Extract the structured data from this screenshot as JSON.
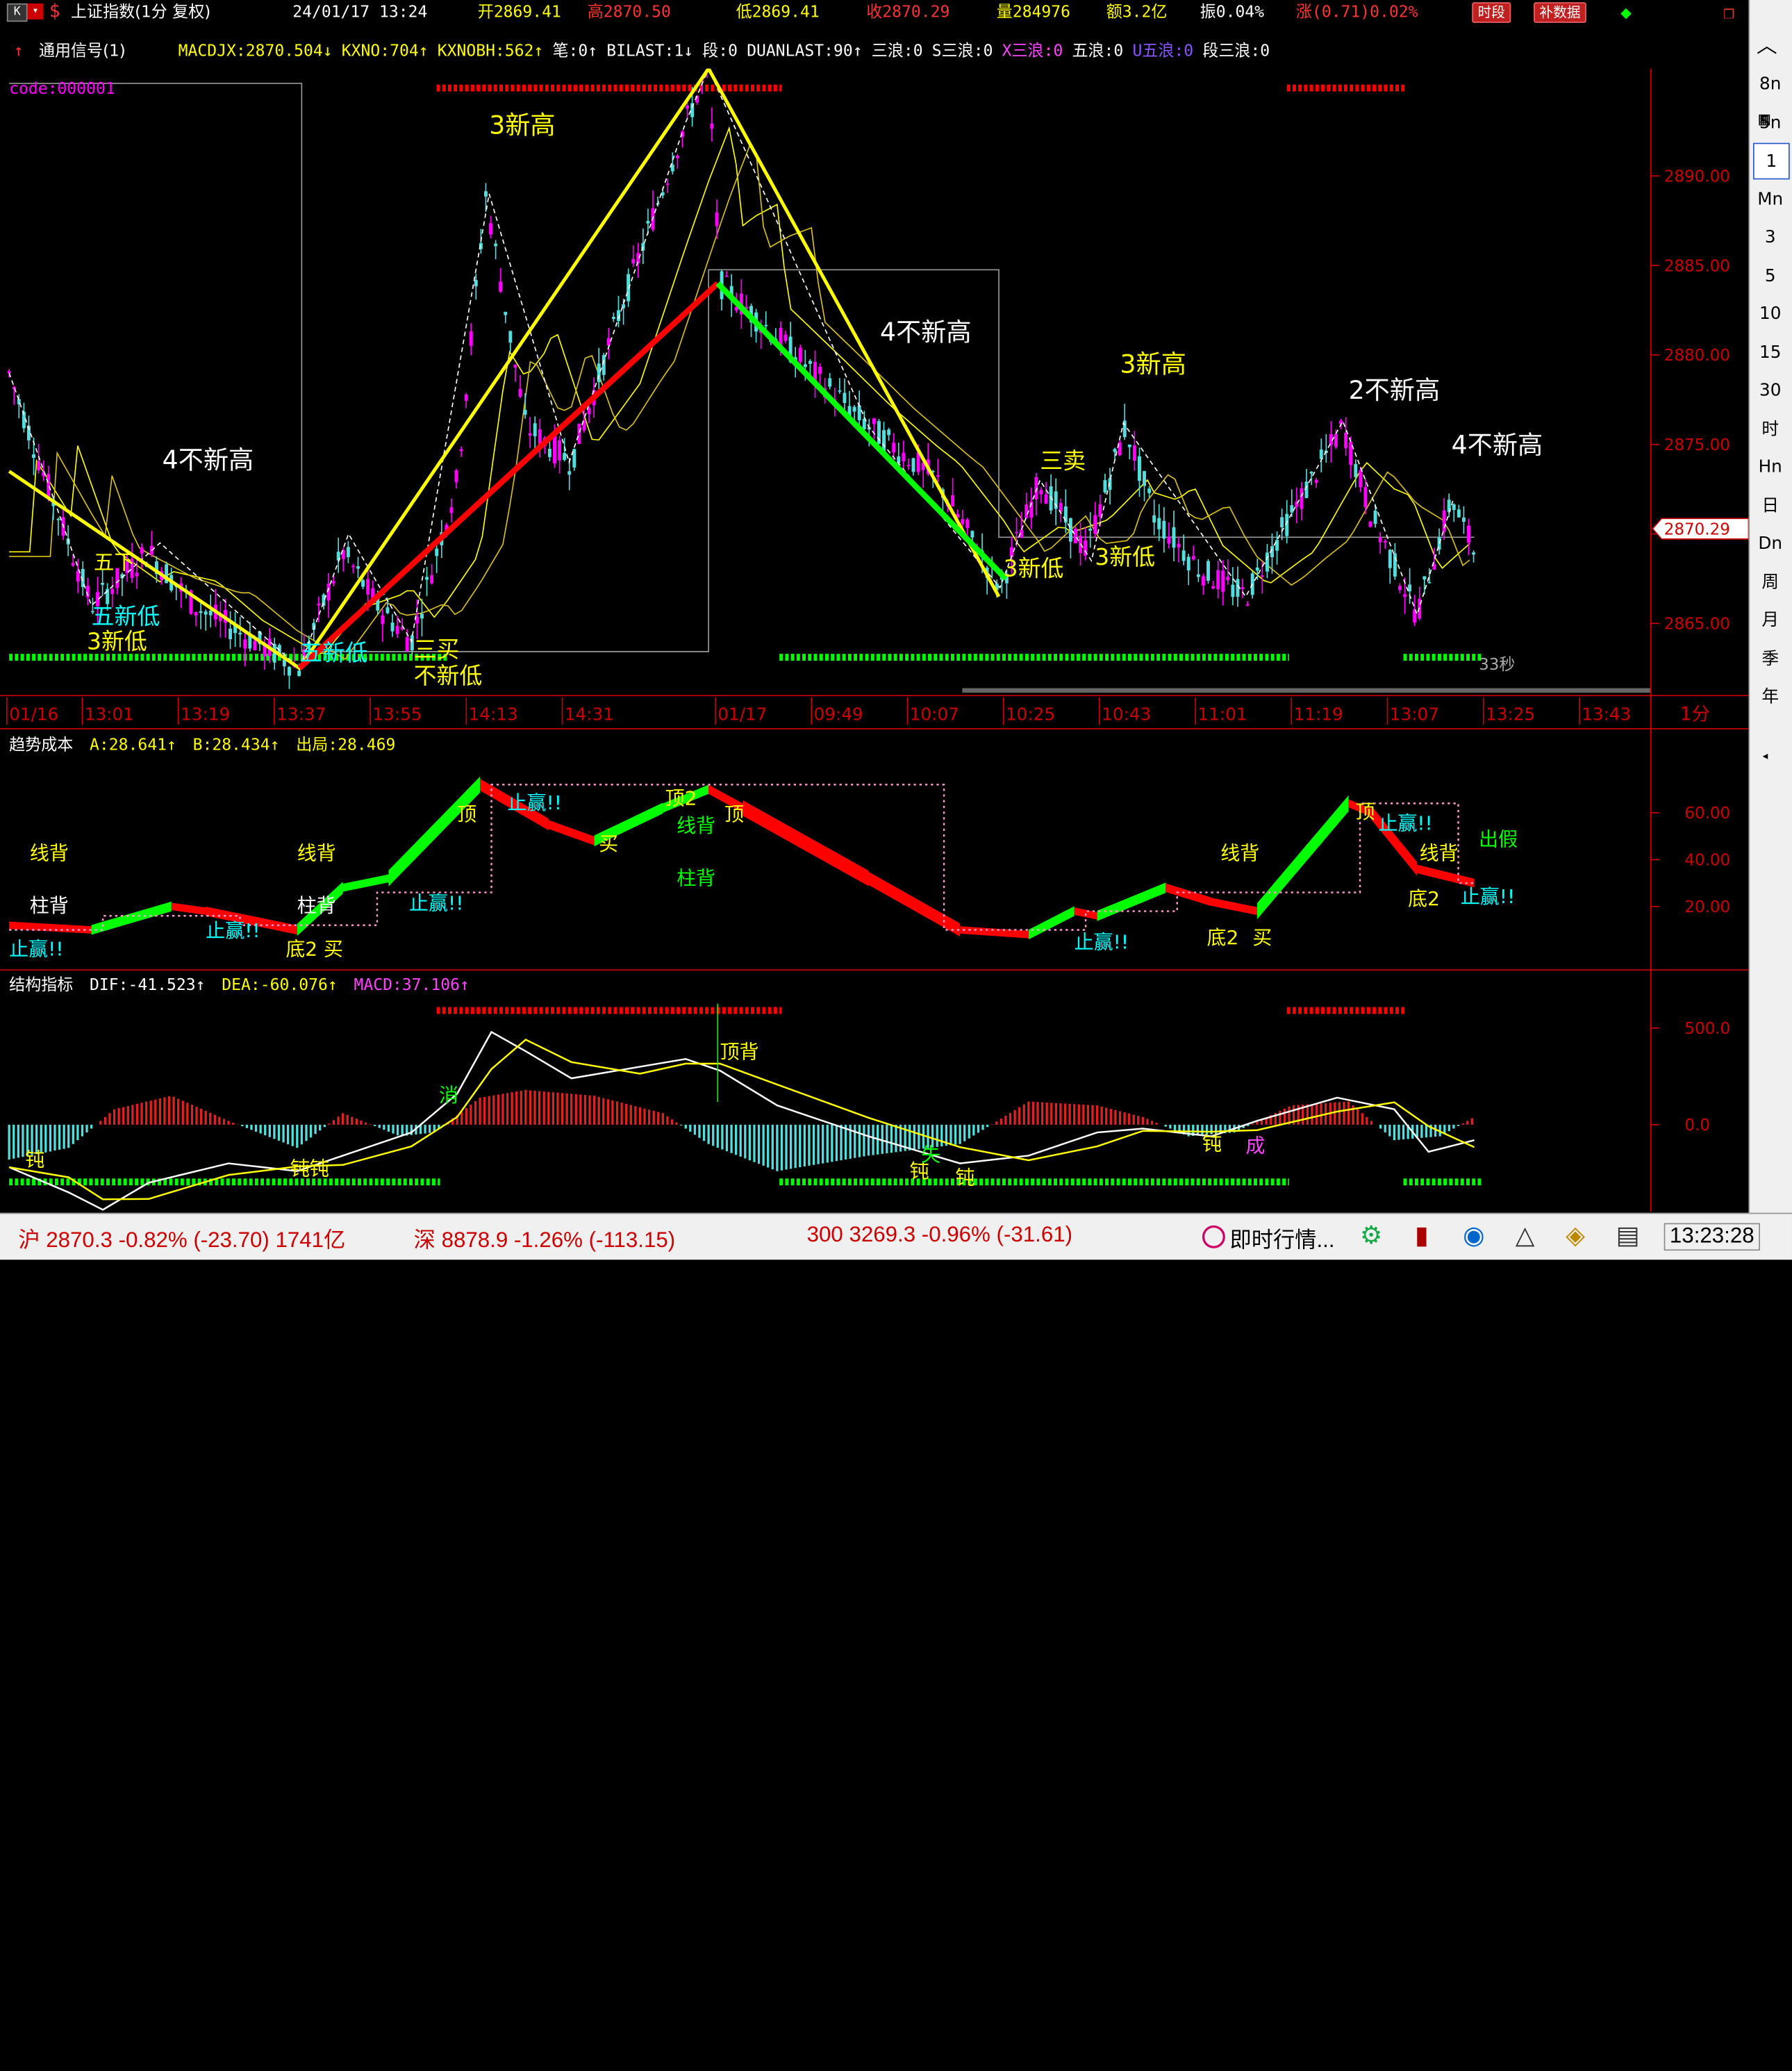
{
  "header": {
    "title": "上证指数(1分 复权)",
    "datetime": "24/01/17 13:24",
    "open": "开2869.41",
    "high": "高2870.50",
    "low": "低2869.41",
    "close": "收2870.29",
    "volume": "量284976",
    "amount": "额3.2亿",
    "amplitude": "振0.04%",
    "change": "涨(0.71)0.02%",
    "btn_period": "时段",
    "btn_supplement": "补数据"
  },
  "signal_line": {
    "name": "通用信号(1)",
    "items": [
      {
        "text": "MACDJX:2870.504↓",
        "color": "#ffff00"
      },
      {
        "text": "KXNO:704↑",
        "color": "#ffff00"
      },
      {
        "text": "KXNOBH:562↑",
        "color": "#ffff00"
      },
      {
        "text": "笔:0↑",
        "color": "#ffffff"
      },
      {
        "text": "BILAST:1↓",
        "color": "#ffffff"
      },
      {
        "text": "段:0",
        "color": "#ffffff"
      },
      {
        "text": "DUANLAST:90↑",
        "color": "#ffffff"
      },
      {
        "text": "三浪:0",
        "color": "#ffffff"
      },
      {
        "text": "S三浪:0",
        "color": "#ffffff"
      },
      {
        "text": "X三浪:0",
        "color": "#ff44ff"
      },
      {
        "text": "五浪:0",
        "color": "#ffffff"
      },
      {
        "text": "U五浪:0",
        "color": "#8855ff"
      },
      {
        "text": "段三浪:0",
        "color": "#ffffff"
      }
    ]
  },
  "main_chart": {
    "code_label": "code:000001",
    "y_ticks": [
      "2890.00",
      "2885.00",
      "2880.00",
      "2875.00",
      "2870.00",
      "2865.00"
    ],
    "current_price": "2870.29",
    "timer": "33秒",
    "annotations": [
      {
        "text": "3新高",
        "color": "#ffff00"
      },
      {
        "text": "4不新高",
        "color": "#ffffff"
      },
      {
        "text": "4不新高",
        "color": "#ffffff"
      },
      {
        "text": "3新高",
        "color": "#ffff00"
      },
      {
        "text": "2不新高",
        "color": "#ffffff"
      },
      {
        "text": "4不新高",
        "color": "#ffffff"
      },
      {
        "text": "五新低",
        "color": "#00ffff"
      },
      {
        "text": "3新低",
        "color": "#ffff00"
      },
      {
        "text": "三买",
        "color": "#ffff00"
      },
      {
        "text": "不新低",
        "color": "#ffff00"
      },
      {
        "text": "三卖",
        "color": "#ffff00"
      },
      {
        "text": "3新低",
        "color": "#ffff00"
      },
      {
        "text": "3新低",
        "color": "#ffff00"
      },
      {
        "text": "五新低",
        "color": "#00ffff"
      },
      {
        "text": "五下",
        "color": "#ffff00"
      }
    ]
  },
  "x_axis": {
    "labels": [
      "01/16",
      "13:01",
      "13:19",
      "13:37",
      "13:55",
      "14:13",
      "14:31",
      "01/17",
      "09:49",
      "10:07",
      "10:25",
      "10:43",
      "11:01",
      "11:19",
      "13:07",
      "13:25",
      "13:43"
    ],
    "period": "1分"
  },
  "trend_panel": {
    "title": "趋势成本",
    "a": "A:28.641↑",
    "b": "B:28.434↑",
    "out": "出局:28.469",
    "y_ticks": [
      "60.00",
      "40.00",
      "20.00"
    ],
    "labels": [
      {
        "text": "线背",
        "color": "#ffff00"
      },
      {
        "text": "柱背",
        "color": "#ffffff"
      },
      {
        "text": "线背",
        "color": "#ffff00"
      },
      {
        "text": "柱背",
        "color": "#ffffff"
      },
      {
        "text": "顶",
        "color": "#ffff00"
      },
      {
        "text": "止赢!!",
        "color": "#00ffff"
      },
      {
        "text": "买",
        "color": "#ffff00"
      },
      {
        "text": "顶2",
        "color": "#ffff00"
      },
      {
        "text": "线背",
        "color": "#00ff00"
      },
      {
        "text": "顶",
        "color": "#ffff00"
      },
      {
        "text": "柱背",
        "color": "#00ff00"
      },
      {
        "text": "止赢!!",
        "color": "#00ffff"
      },
      {
        "text": "止赢!!",
        "color": "#00ffff"
      },
      {
        "text": "底2 买",
        "color": "#ffff00"
      },
      {
        "text": "止赢!!",
        "color": "#00ffff"
      },
      {
        "text": "止赢!!",
        "color": "#00ffff"
      },
      {
        "text": "线背",
        "color": "#ffff00"
      },
      {
        "text": "底2",
        "color": "#ffff00"
      },
      {
        "text": "买",
        "color": "#ffff00"
      },
      {
        "text": "顶",
        "color": "#ffff00"
      },
      {
        "text": "止赢!!",
        "color": "#00ffff"
      },
      {
        "text": "线背",
        "color": "#ffff00"
      },
      {
        "text": "底2",
        "color": "#ffff00"
      },
      {
        "text": "止赢!!",
        "color": "#00ffff"
      },
      {
        "text": "出假",
        "color": "#00ff00"
      }
    ]
  },
  "structure_panel": {
    "title": "结构指标",
    "dif": "DIF:-41.523↑",
    "dea": "DEA:-60.076↑",
    "macd": "MACD:37.106↑",
    "y_ticks": [
      "500.0",
      "0.0"
    ],
    "labels": [
      {
        "text": "钝",
        "color": "#ffff00"
      },
      {
        "text": "钝钝",
        "color": "#ffff00"
      },
      {
        "text": "消",
        "color": "#00ff00"
      },
      {
        "text": "顶背",
        "color": "#ffff00"
      },
      {
        "text": "钝",
        "color": "#ffff00"
      },
      {
        "text": "失",
        "color": "#00ff00"
      },
      {
        "text": "钝",
        "color": "#ffff00"
      },
      {
        "text": "钝",
        "color": "#ffff00"
      },
      {
        "text": "成",
        "color": "#ff44ff"
      }
    ]
  },
  "right_periods": [
    "8n",
    "5n",
    "1",
    "Mn",
    "3",
    "5",
    "10",
    "15",
    "30",
    "时",
    "Hn",
    "日",
    "Dn",
    "周",
    "月",
    "季",
    "年"
  ],
  "status_bar": {
    "sh": "沪 2870.3 -0.82% (-23.70) 1741亿",
    "sz": "深 8878.9 -1.26% (-113.15)",
    "csi300": "300 3269.3 -0.96% (-31.61)",
    "realtime": "即时行情...",
    "time": "13:23:28"
  },
  "colors": {
    "up": "#ff00ff",
    "down": "#55dddd",
    "red_line": "#ff0000",
    "green_line": "#00ff00",
    "yellow_line": "#ffff00",
    "axis_red": "#cc0000"
  }
}
